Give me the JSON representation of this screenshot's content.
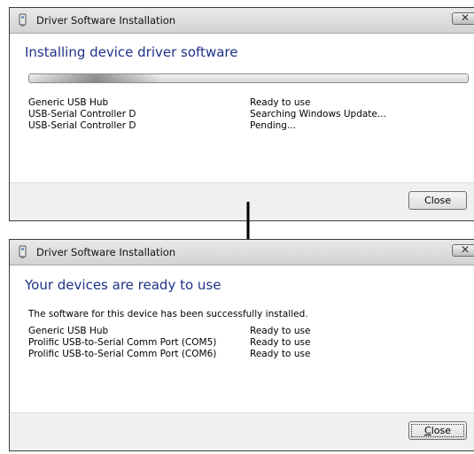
{
  "window1": {
    "title": "Driver Software Installation",
    "heading": "Installing device driver software",
    "progress": {
      "state": "indeterminate"
    },
    "devices": [
      {
        "name": "Generic USB Hub",
        "status": "Ready to use"
      },
      {
        "name": "USB-Serial Controller D",
        "status": "Searching Windows Update..."
      },
      {
        "name": "USB-Serial Controller D",
        "status": "Pending..."
      }
    ],
    "close_button": "Close"
  },
  "window2": {
    "title": "Driver Software Installation",
    "heading": "Your devices are ready to use",
    "message": "The software for this device has been successfully installed.",
    "devices": [
      {
        "name": "Generic USB Hub",
        "status": "Ready to use"
      },
      {
        "name": "Prolific USB-to-Serial Comm Port (COM5)",
        "status": "Ready to use"
      },
      {
        "name": "Prolific USB-to-Serial Comm Port (COM6)",
        "status": "Ready to use"
      }
    ],
    "close_button_mnemonic": "C",
    "close_button_rest": "lose"
  },
  "icons": {
    "app": "usb-device-icon",
    "window_close": "close-icon",
    "transition": "arrow-down-icon"
  },
  "colors": {
    "heading": "#1e3287",
    "footer": "#f0f0f0",
    "titlebar": "#dcdcdc"
  }
}
